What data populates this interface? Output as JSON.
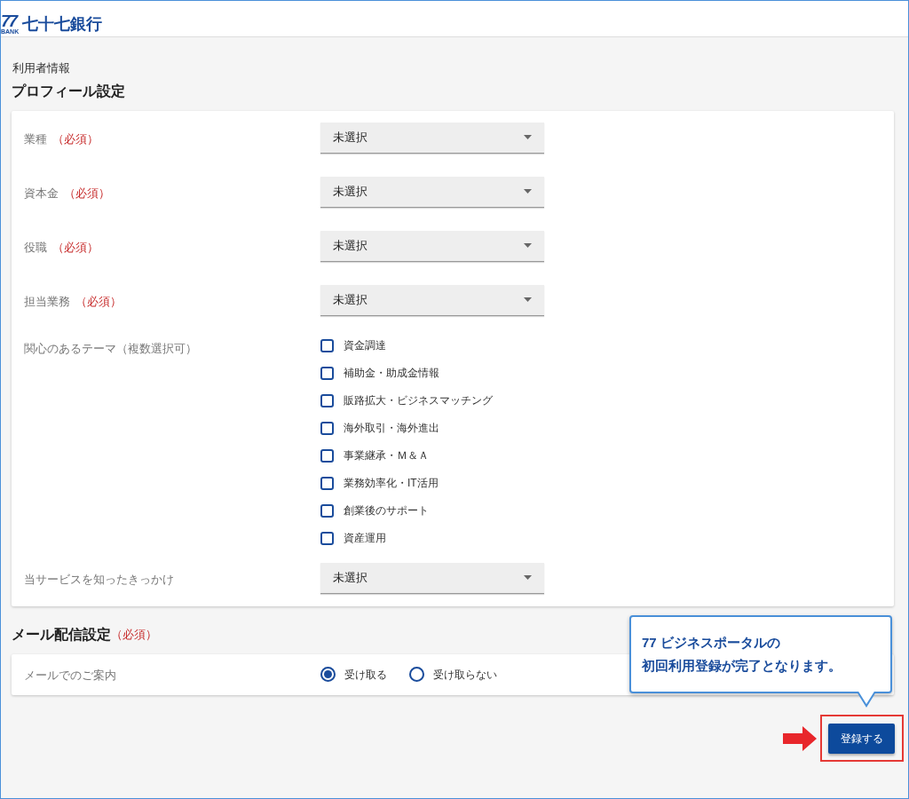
{
  "header": {
    "logo_mark": "77",
    "logo_sub": "BANK",
    "logo_text": "七十七銀行"
  },
  "breadcrumb": "利用者情報",
  "title": "プロフィール設定",
  "profile_fields": [
    {
      "kind": "select",
      "label": "業種",
      "required": "（必須）",
      "value": "未選択"
    },
    {
      "kind": "select",
      "label": "資本金",
      "required": "（必須）",
      "value": "未選択"
    },
    {
      "kind": "select",
      "label": "役職",
      "required": "（必須）",
      "value": "未選択"
    },
    {
      "kind": "select",
      "label": "担当業務",
      "required": "（必須）",
      "value": "未選択"
    },
    {
      "kind": "checkboxes",
      "label": "関心のあるテーマ（複数選択可）",
      "options": [
        {
          "label": "資金調達",
          "checked": false
        },
        {
          "label": "補助金・助成金情報",
          "checked": false
        },
        {
          "label": "販路拡大・ビジネスマッチング",
          "checked": false
        },
        {
          "label": "海外取引・海外進出",
          "checked": false
        },
        {
          "label": "事業継承・Ｍ＆Ａ",
          "checked": false
        },
        {
          "label": "業務効率化・IT活用",
          "checked": false
        },
        {
          "label": "創業後のサポート",
          "checked": false
        },
        {
          "label": "資産運用",
          "checked": false
        }
      ]
    },
    {
      "kind": "select",
      "label": "当サービスを知ったきっかけ",
      "value": "未選択"
    }
  ],
  "mail_section": {
    "title": "メール配信設定",
    "required": "（必須）",
    "label": "メールでのご案内",
    "options": [
      {
        "label": "受け取る",
        "selected": true
      },
      {
        "label": "受け取らない",
        "selected": false
      }
    ]
  },
  "callout": {
    "lines": [
      "77 ビジネスポータルの",
      "初回利用登録が完了となります。"
    ]
  },
  "submit_button": "登録する"
}
